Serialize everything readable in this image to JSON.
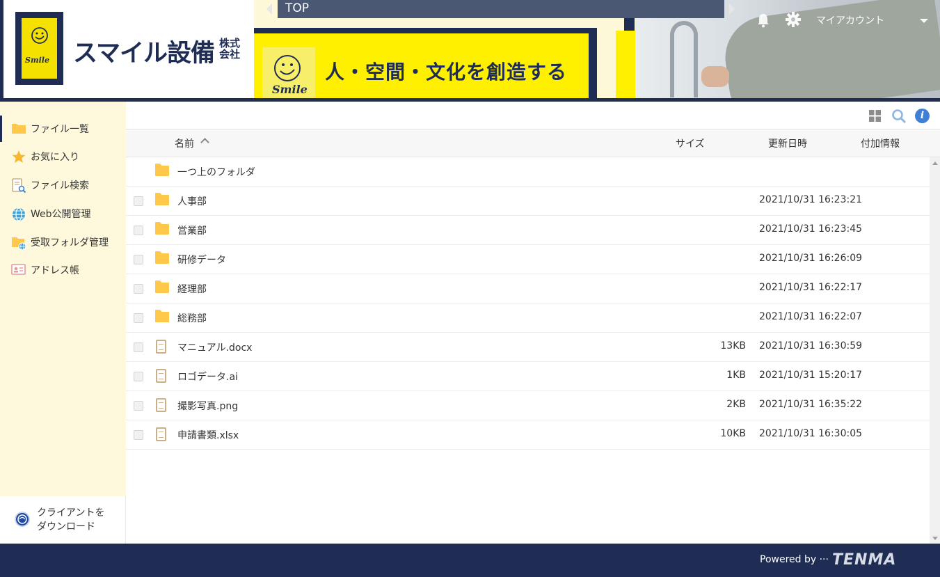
{
  "header": {
    "company_name": "スマイル設備",
    "company_suffix": "株式会社",
    "logo_word": "Smile",
    "tagline": "人・空間・文化を創造する",
    "breadcrumb": "TOP",
    "account_label": "マイアカウント"
  },
  "sidebar": {
    "items": [
      {
        "label": "ファイル一覧",
        "icon": "folder-icon"
      },
      {
        "label": "お気に入り",
        "icon": "star-icon"
      },
      {
        "label": "ファイル検索",
        "icon": "file-search-icon"
      },
      {
        "label": "Web公開管理",
        "icon": "globe-icon"
      },
      {
        "label": "受取フォルダ管理",
        "icon": "inbox-folder-icon"
      },
      {
        "label": "アドレス帳",
        "icon": "address-book-icon"
      }
    ],
    "client_download": "クライアントを\nダウンロード"
  },
  "table": {
    "columns": {
      "name": "名前",
      "size": "サイズ",
      "modified": "更新日時",
      "extra": "付加情報"
    },
    "parent_folder": "一つ上のフォルダ",
    "rows": [
      {
        "name": "人事部",
        "type": "folder",
        "size": "",
        "modified": "2021/10/31 16:23:21"
      },
      {
        "name": "営業部",
        "type": "folder",
        "size": "",
        "modified": "2021/10/31 16:23:45"
      },
      {
        "name": "研修データ",
        "type": "folder",
        "size": "",
        "modified": "2021/10/31 16:26:09"
      },
      {
        "name": "経理部",
        "type": "folder",
        "size": "",
        "modified": "2021/10/31 16:22:17"
      },
      {
        "name": "総務部",
        "type": "folder",
        "size": "",
        "modified": "2021/10/31 16:22:07"
      },
      {
        "name": "マニュアル.docx",
        "type": "file",
        "size": "13KB",
        "modified": "2021/10/31 16:30:59"
      },
      {
        "name": "ロゴデータ.ai",
        "type": "file",
        "size": "1KB",
        "modified": "2021/10/31 15:20:17"
      },
      {
        "name": "撮影写真.png",
        "type": "file",
        "size": "2KB",
        "modified": "2021/10/31 16:35:22"
      },
      {
        "name": "申請書類.xlsx",
        "type": "file",
        "size": "10KB",
        "modified": "2021/10/31 16:30:05"
      }
    ]
  },
  "footer": {
    "powered_by": "Powered by ···",
    "brand": "TENMA"
  },
  "colors": {
    "navy": "#1f2d55",
    "yellow": "#fff000",
    "sidebar_bg": "#fef9dc",
    "folder": "#ffc84a",
    "info_blue": "#3d80d6"
  }
}
